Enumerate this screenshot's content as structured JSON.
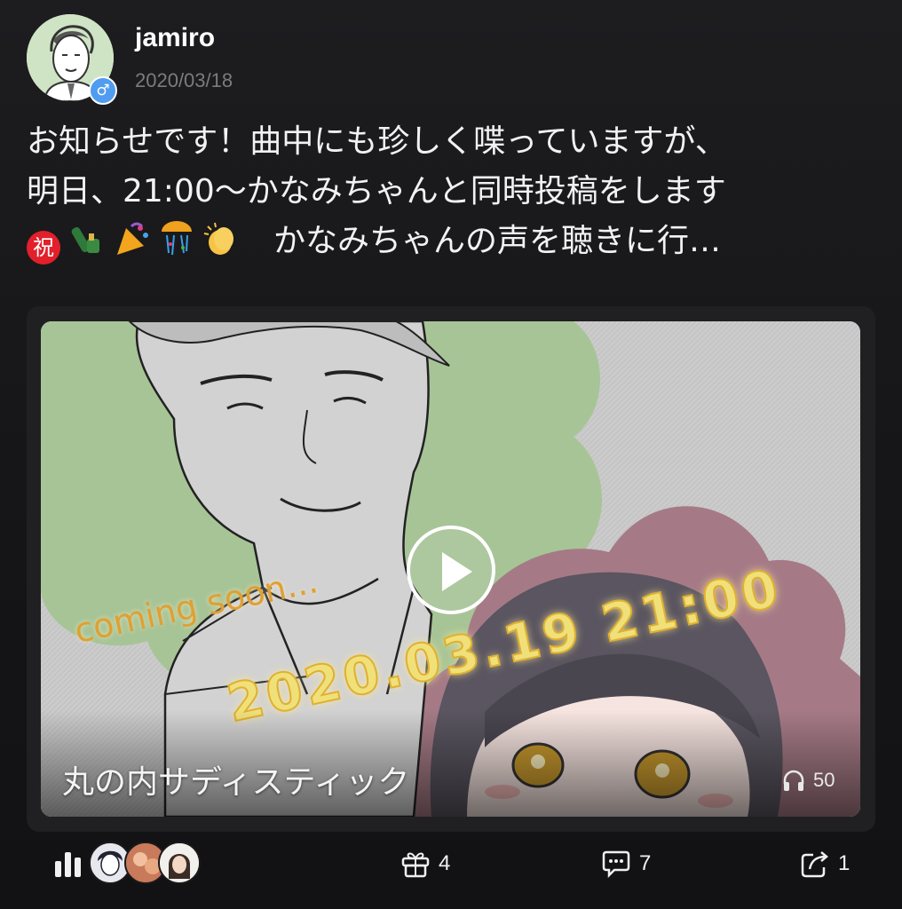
{
  "post": {
    "username": "jamiro",
    "date": "2020/03/18",
    "gender_symbol": "♂",
    "text_lines": [
      "お知らせです！曲中にも珍しく喋っていますが、",
      "明日、21:00〜かなみちゃんと同時投稿をします"
    ],
    "line3_tail": "かなみちゃんの声を聴きに行…",
    "iwai_badge": "祝"
  },
  "media": {
    "title": "丸の内サディスティック",
    "play_count": "50",
    "overlay_soon": "coming soon...",
    "overlay_date": "2020.03.19 21:00"
  },
  "footer": {
    "gifts": "4",
    "comments": "7",
    "shares": "1"
  },
  "colors": {
    "background": "#141416",
    "accent_gender": "#4f9cf0",
    "overlay_orange": "#e0a033",
    "overlay_yellow": "#f0e07a"
  },
  "icons": [
    "gender-male-icon",
    "play-icon",
    "headphones-icon",
    "bar-chart-icon",
    "gift-icon",
    "comment-icon",
    "share-icon"
  ]
}
